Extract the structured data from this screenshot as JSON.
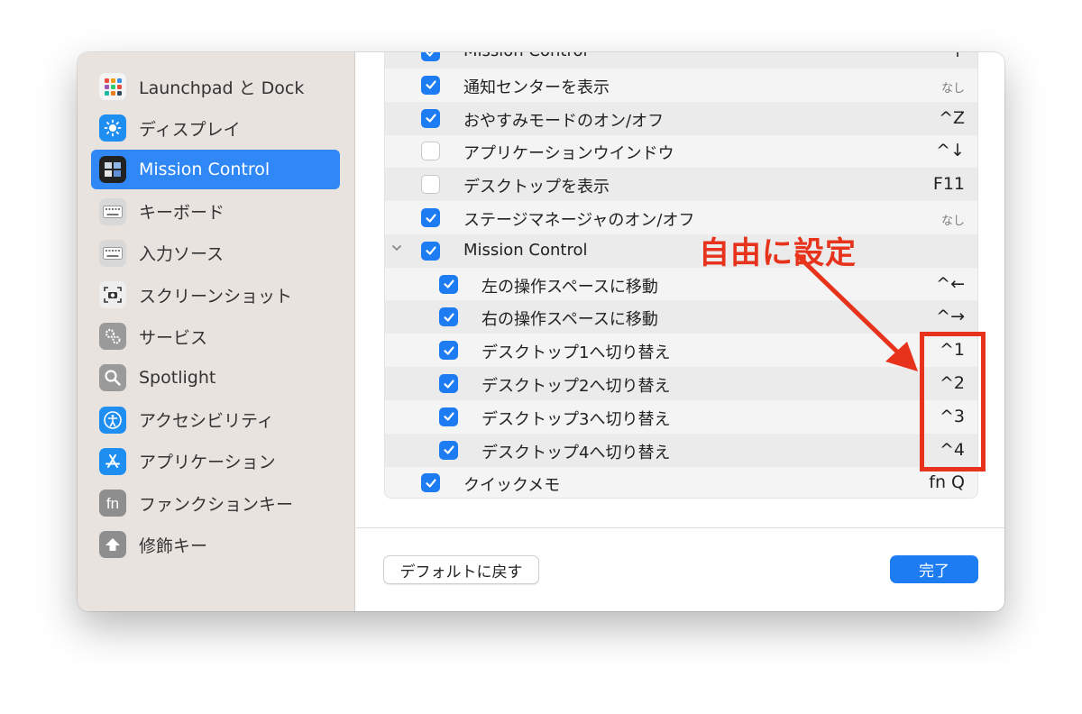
{
  "sidebar": {
    "items": [
      {
        "label": "Launchpad と Dock",
        "icon": "launchpad-icon",
        "active": false
      },
      {
        "label": "ディスプレイ",
        "icon": "display-icon",
        "active": false
      },
      {
        "label": "Mission Control",
        "icon": "mission-control-icon",
        "active": true
      },
      {
        "label": "キーボード",
        "icon": "keyboard-icon",
        "active": false
      },
      {
        "label": "入力ソース",
        "icon": "input-sources-icon",
        "active": false
      },
      {
        "label": "スクリーンショット",
        "icon": "screenshot-icon",
        "active": false
      },
      {
        "label": "サービス",
        "icon": "services-icon",
        "active": false
      },
      {
        "label": "Spotlight",
        "icon": "spotlight-icon",
        "active": false
      },
      {
        "label": "アクセシビリティ",
        "icon": "accessibility-icon",
        "active": false
      },
      {
        "label": "アプリケーション",
        "icon": "app-store-icon",
        "active": false
      },
      {
        "label": "ファンクションキー",
        "icon": "fn-key-icon",
        "active": false
      },
      {
        "label": "修飾キー",
        "icon": "modifier-keys-icon",
        "active": false
      }
    ]
  },
  "shortcuts": {
    "rows": [
      {
        "label": "Mission Control",
        "key": "↑",
        "checked": true,
        "indent": false
      },
      {
        "label": "通知センターを表示",
        "key": "なし",
        "checked": true,
        "indent": false,
        "key_small": true
      },
      {
        "label": "おやすみモードのオン/オフ",
        "key": "^Z",
        "checked": true,
        "indent": false
      },
      {
        "label": "アプリケーションウインドウ",
        "key": "^↓",
        "checked": false,
        "indent": false
      },
      {
        "label": "デスクトップを表示",
        "key": "F11",
        "checked": false,
        "indent": false
      },
      {
        "label": "ステージマネージャのオン/オフ",
        "key": "なし",
        "checked": true,
        "indent": false,
        "key_small": true
      },
      {
        "label": "Mission Control",
        "key": "",
        "checked": true,
        "indent": false,
        "expandable": true
      },
      {
        "label": "左の操作スペースに移動",
        "key": "^←",
        "checked": true,
        "indent": true
      },
      {
        "label": "右の操作スペースに移動",
        "key": "^→",
        "checked": true,
        "indent": true
      },
      {
        "label": "デスクトップ1へ切り替え",
        "key": "^1",
        "checked": true,
        "indent": true
      },
      {
        "label": "デスクトップ2へ切り替え",
        "key": "^2",
        "checked": true,
        "indent": true
      },
      {
        "label": "デスクトップ3へ切り替え",
        "key": "^3",
        "checked": true,
        "indent": true
      },
      {
        "label": "デスクトップ4へ切り替え",
        "key": "^4",
        "checked": true,
        "indent": true
      },
      {
        "label": "クイックメモ",
        "key": "fn Q",
        "checked": true,
        "indent": false
      }
    ]
  },
  "footer": {
    "restore_defaults_label": "デフォルトに戻す",
    "done_label": "完了"
  },
  "annotation": {
    "text": "自由に設定",
    "color": "#e8331c"
  },
  "colors": {
    "accent": "#1d7cf2",
    "sidebar_bg": "#e9e3df"
  }
}
